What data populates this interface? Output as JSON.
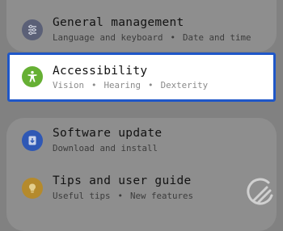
{
  "settings": {
    "general": {
      "title": "General management",
      "sub1": "Language and keyboard",
      "sub2": "Date and time",
      "icon": "sliders-icon"
    },
    "accessibility": {
      "title": "Accessibility",
      "sub1": "Vision",
      "sub2": "Hearing",
      "sub3": "Dexterity",
      "icon": "accessibility-person-icon",
      "highlight_color": "#1f57c8"
    },
    "software_update": {
      "title": "Software update",
      "sub1": "Download and install",
      "icon": "software-update-icon"
    },
    "tips": {
      "title": "Tips and user guide",
      "sub1": "Useful tips",
      "sub2": "New features",
      "icon": "lightbulb-icon"
    }
  },
  "separator": "•",
  "watermark": {
    "icon": "watermark-logo-icon"
  }
}
